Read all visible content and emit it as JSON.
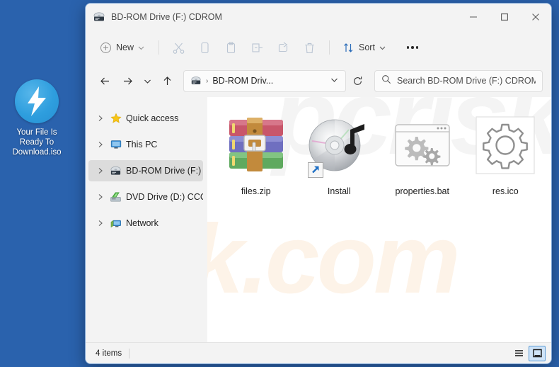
{
  "desktop": {
    "background_color": "#2a62ad",
    "icon": {
      "name": "daemon-tools-iso-icon",
      "label": "Your File Is\nReady To\nDownload.iso",
      "label_line1": "Your File Is",
      "label_line2": "Ready To",
      "label_line3": "Download.iso",
      "badge_color": "#2e9ede"
    }
  },
  "window": {
    "title": "BD-ROM Drive (F:) CDROM",
    "title_icon": "bd-rom-drive-icon",
    "controls": {
      "minimize": "Minimize",
      "maximize": "Maximize",
      "close": "Close"
    }
  },
  "toolbar": {
    "new_label": "New",
    "sort_label": "Sort",
    "items": [
      {
        "name": "new-button",
        "label": "New",
        "icon": "plus-circle-icon",
        "enabled": true
      },
      {
        "name": "cut-button",
        "label": "Cut",
        "icon": "scissors-icon",
        "enabled": false
      },
      {
        "name": "copy-button",
        "label": "Copy",
        "icon": "copy-icon",
        "enabled": false
      },
      {
        "name": "paste-button",
        "label": "Paste",
        "icon": "clipboard-icon",
        "enabled": false
      },
      {
        "name": "rename-button",
        "label": "Rename",
        "icon": "rename-icon",
        "enabled": false
      },
      {
        "name": "share-button",
        "label": "Share",
        "icon": "share-icon",
        "enabled": false
      },
      {
        "name": "delete-button",
        "label": "Delete",
        "icon": "trash-icon",
        "enabled": false
      },
      {
        "name": "sort-button",
        "label": "Sort",
        "icon": "sort-arrows-icon",
        "enabled": true
      },
      {
        "name": "more-button",
        "label": "See more",
        "icon": "ellipsis-icon",
        "enabled": true
      }
    ]
  },
  "addressbar": {
    "back": "Back",
    "forward": "Forward",
    "recent": "Recent locations",
    "up": "Up",
    "path_text": "BD-ROM Driv...",
    "path_icon": "bd-rom-drive-icon",
    "path_separator": "›",
    "refresh": "Refresh",
    "search_placeholder": "Search BD-ROM Drive (F:) CDROM",
    "search_value": ""
  },
  "sidebar": {
    "items": [
      {
        "name": "sidebar-item-quick-access",
        "label": "Quick access",
        "icon": "star-icon",
        "selected": false
      },
      {
        "name": "sidebar-item-this-pc",
        "label": "This PC",
        "icon": "monitor-icon",
        "selected": false
      },
      {
        "name": "sidebar-item-bd-rom-drive",
        "label": "BD-ROM Drive (F:) C",
        "icon": "bd-rom-drive-icon",
        "selected": true
      },
      {
        "name": "sidebar-item-dvd-drive",
        "label": "DVD Drive (D:) CCCC",
        "icon": "dvd-drive-icon",
        "selected": false
      },
      {
        "name": "sidebar-item-network",
        "label": "Network",
        "icon": "network-icon",
        "selected": false
      }
    ]
  },
  "content": {
    "watermark": "risk.com",
    "watermark_top": "pcrisk",
    "files": [
      {
        "name": "file-item-files-zip",
        "label": "files.zip",
        "icon": "winrar-archive-icon",
        "shortcut": false
      },
      {
        "name": "file-item-install",
        "label": "Install",
        "icon": "cd-media-icon",
        "shortcut": true
      },
      {
        "name": "file-item-properties-bat",
        "label": "properties.bat",
        "icon": "batch-gears-icon",
        "shortcut": false
      },
      {
        "name": "file-item-res-ico",
        "label": "res.ico",
        "icon": "gear-outline-icon",
        "shortcut": false
      }
    ]
  },
  "statusbar": {
    "item_count": "4 items",
    "views": [
      {
        "name": "details-view-button",
        "label": "Details view",
        "icon": "list-lines-icon",
        "active": false
      },
      {
        "name": "large-icons-view-button",
        "label": "Large icons view",
        "icon": "large-icon-view-icon",
        "active": true
      }
    ]
  }
}
